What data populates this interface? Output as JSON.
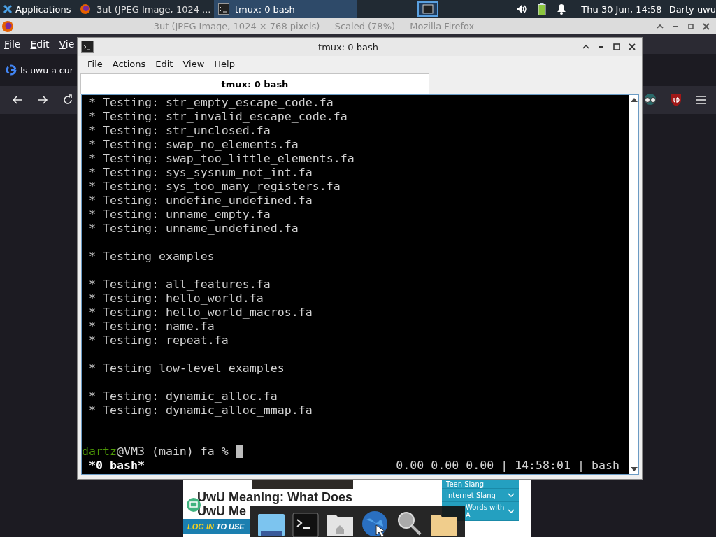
{
  "top_panel": {
    "applications": "Applications",
    "tasks": [
      {
        "title": "3ut (JPEG Image, 1024 ...",
        "kind": "browser",
        "selected": false
      },
      {
        "title": "tmux: 0 bash",
        "kind": "terminal",
        "selected": true
      }
    ],
    "clock": "Thu 30 Jun, 14:58",
    "user": "Darty uwu"
  },
  "browser": {
    "title": "3ut (JPEG Image, 1024 × 768 pixels) — Scaled (78%) — Mozilla Firefox",
    "menu": [
      "File",
      "Edit",
      "Vie"
    ],
    "tab": "Is uwu a cur",
    "page": {
      "heading": [
        "UwU Meaning: What Does",
        "UwU Me"
      ],
      "banner": [
        "LOG IN",
        "TO USE"
      ],
      "sidebar": [
        {
          "label": "Teen Slang"
        },
        {
          "label": "Internet Slang"
        },
        {
          "label": "Words with A"
        }
      ]
    }
  },
  "terminal": {
    "title": "tmux: 0 bash",
    "menu": [
      "File",
      "Actions",
      "Edit",
      "View",
      "Help"
    ],
    "tabs": [
      {
        "label": "tmux: 0 bash",
        "selected": true
      }
    ],
    "blocks": [
      [
        "* Testing: str_empty_escape_code.fa",
        "* Testing: str_invalid_escape_code.fa",
        "* Testing: str_unclosed.fa",
        "* Testing: swap_no_elements.fa",
        "* Testing: swap_too_little_elements.fa",
        "* Testing: sys_sysnum_not_int.fa",
        "* Testing: sys_too_many_registers.fa",
        "* Testing: undefine_undefined.fa",
        "* Testing: unname_empty.fa",
        "* Testing: unname_undefined.fa"
      ],
      [
        "* Testing examples"
      ],
      [
        "* Testing: all_features.fa",
        "* Testing: hello_world.fa",
        "* Testing: hello_world_macros.fa",
        "* Testing: name.fa",
        "* Testing: repeat.fa"
      ],
      [
        "* Testing low-level examples"
      ],
      [
        "* Testing: dynamic_alloc.fa",
        "* Testing: dynamic_alloc_mmap.fa"
      ]
    ],
    "prompt": {
      "user": "dartz",
      "rest": "@VM3 (main) fa %"
    },
    "status": {
      "left": "*0 bash*",
      "right": "0.00 0.00 0.00 | 14:58:01 | bash"
    }
  }
}
